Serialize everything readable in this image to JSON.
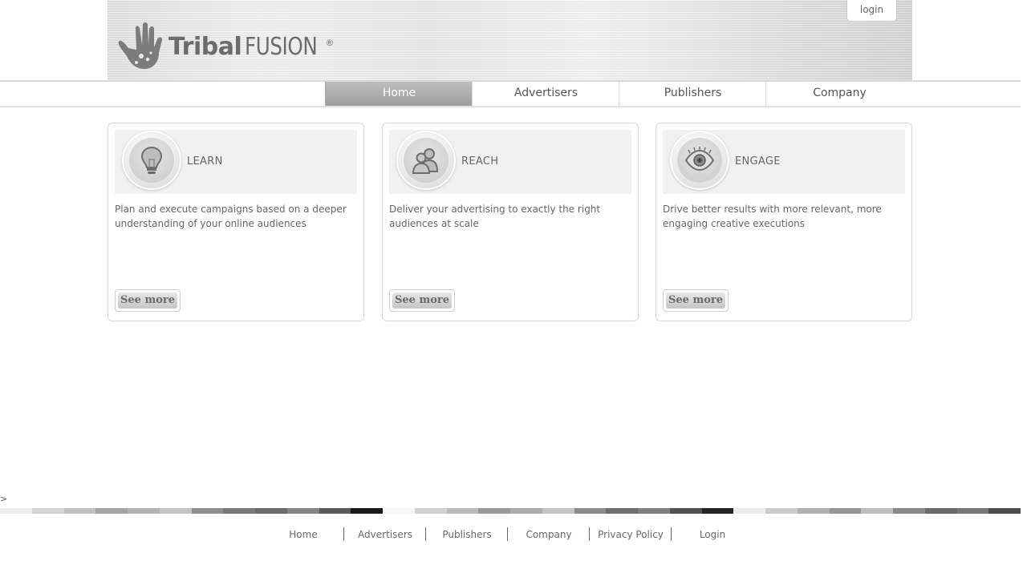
{
  "header": {
    "login_label": "login",
    "logo_word1": "Tribal",
    "logo_word2": "FUSION",
    "logo_mark": "®"
  },
  "nav": {
    "items": [
      {
        "label": "Home",
        "active": true
      },
      {
        "label": "Advertisers",
        "active": false
      },
      {
        "label": "Publishers",
        "active": false
      },
      {
        "label": "Company",
        "active": false
      }
    ]
  },
  "cards": [
    {
      "title": "LEARN",
      "icon": "lightbulb-icon",
      "description": "Plan and execute campaigns based on a deeper understanding of your online audiences",
      "button": "See more"
    },
    {
      "title": "REACH",
      "icon": "people-icon",
      "description": "Deliver your advertising to exactly the right audiences at scale",
      "button": "See more"
    },
    {
      "title": "ENGAGE",
      "icon": "eye-icon",
      "description": "Drive better results with more relevant, more engaging creative executions",
      "button": "See more"
    }
  ],
  "stray_text": ">",
  "stripe_colors": [
    "#ededed",
    "#d4d4d4",
    "#c0c0c0",
    "#a3a3a3",
    "#b3b3b3",
    "#c4c4c4",
    "#8f8f8f",
    "#7a7a7a",
    "#6b6b6b",
    "#858585",
    "#5a5a5a",
    "#1a1a1a",
    "#f5f5f5",
    "#d0d0d0",
    "#b9b9b9",
    "#999999",
    "#acacac",
    "#c3c3c3",
    "#8c8c8c",
    "#6e6e6e",
    "#808080",
    "#525252",
    "#242424",
    "#ececec",
    "#cccccc",
    "#b0b0b0",
    "#959595",
    "#bdbdbd",
    "#8a8a8a",
    "#6a6a6a",
    "#777777",
    "#4e4e4e"
  ],
  "footer": {
    "links": [
      "Home",
      "Advertisers",
      "Publishers",
      "Company",
      "Privacy Policy",
      "Login"
    ]
  }
}
